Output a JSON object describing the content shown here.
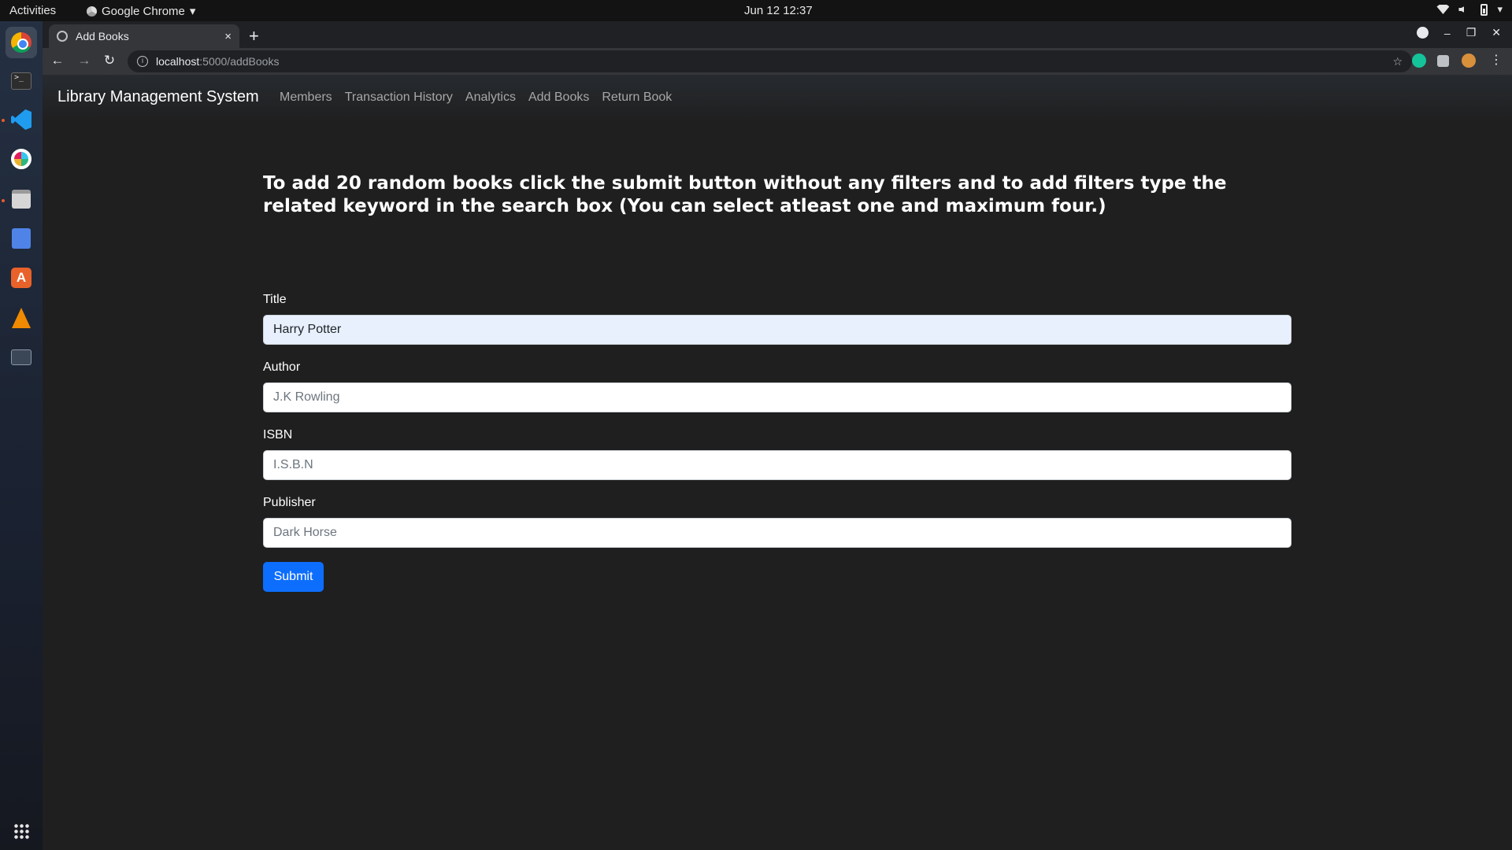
{
  "system_bar": {
    "activities": "Activities",
    "app_name": "Google Chrome",
    "clock": "Jun 12  12:37"
  },
  "dock": {
    "items": [
      "chrome-icon",
      "terminal-icon",
      "vscode-icon",
      "slack-icon",
      "files-icon",
      "tasks-icon",
      "software-store-icon",
      "vlc-icon",
      "system-monitor-icon"
    ],
    "apps_grid": "show-apps-icon"
  },
  "browser": {
    "tab_title": "Add Books",
    "tab_close": "×",
    "new_tab": "+",
    "url_host": "localhost",
    "url_path": ":5000/addBooks",
    "back": "←",
    "forward": "→",
    "reload": "↻",
    "star": "☆",
    "menu": "⋮",
    "window_min": "–",
    "window_restore": "❐",
    "window_close": "✕"
  },
  "navbar": {
    "brand": "Library Management System",
    "links": [
      "Members",
      "Transaction History",
      "Analytics",
      "Add Books",
      "Return Book"
    ]
  },
  "intro": "To add 20 random books click the submit button without any filters and to add filters type the related keyword in the search box (You can select atleast one and maximum four.)",
  "form": {
    "title": {
      "label": "Title",
      "value": "Harry Potter",
      "placeholder": ""
    },
    "author": {
      "label": "Author",
      "value": "",
      "placeholder": "J.K Rowling"
    },
    "isbn": {
      "label": "ISBN",
      "value": "",
      "placeholder": "I.S.B.N"
    },
    "publisher": {
      "label": "Publisher",
      "value": "",
      "placeholder": "Dark Horse"
    },
    "submit_label": "Submit"
  },
  "colors": {
    "page_background": "#1f1f1f",
    "submit_button": "#0d6efd",
    "autofill_background": "#e8f0fe"
  }
}
